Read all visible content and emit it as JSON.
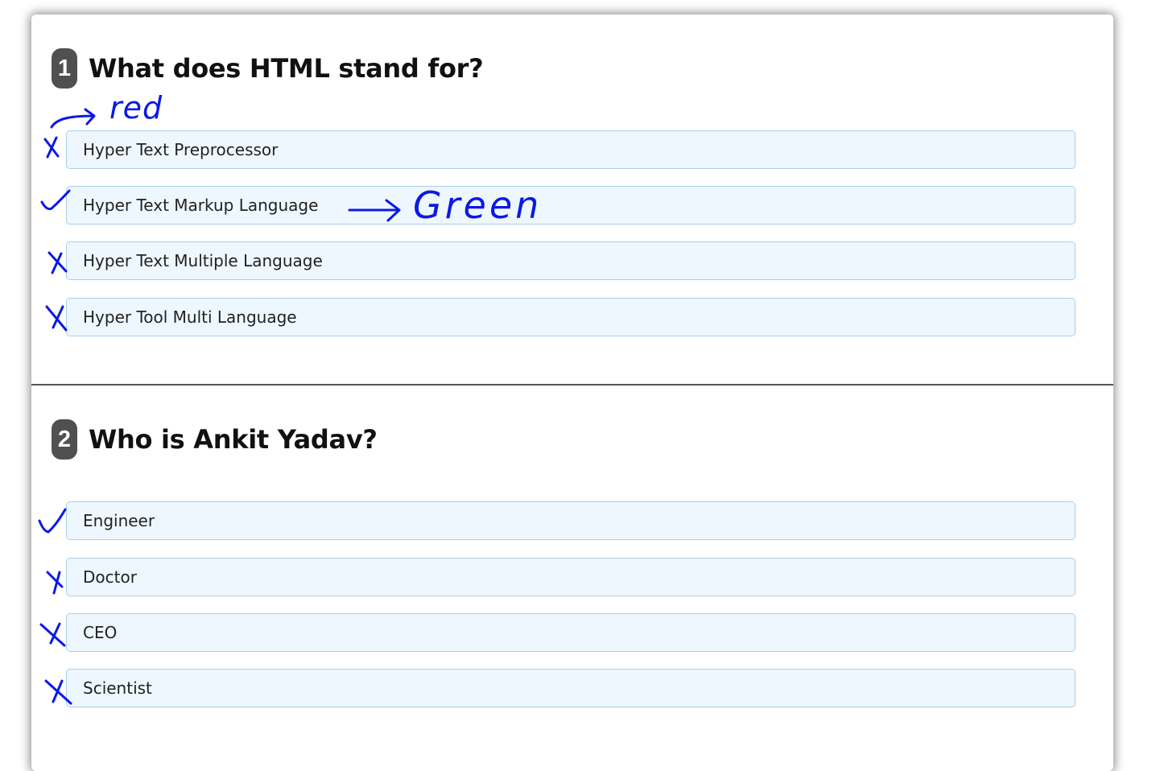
{
  "questions": [
    {
      "number": "1",
      "text": "What does HTML stand for?",
      "options": [
        {
          "label": "Hyper Text Preprocessor",
          "mark": "cross"
        },
        {
          "label": "Hyper Text Markup Language",
          "mark": "check"
        },
        {
          "label": "Hyper Text Multiple Language",
          "mark": "cross"
        },
        {
          "label": "Hyper Tool Multi Language",
          "mark": "cross"
        }
      ]
    },
    {
      "number": "2",
      "text": "Who is Ankit Yadav?",
      "options": [
        {
          "label": "Engineer",
          "mark": "check"
        },
        {
          "label": "Doctor",
          "mark": "cross"
        },
        {
          "label": "CEO",
          "mark": "cross"
        },
        {
          "label": "Scientist",
          "mark": "cross"
        }
      ]
    }
  ],
  "annotations": {
    "wrong_note": "red",
    "right_note": "Green",
    "ink_color": "#0b19e6"
  },
  "colors": {
    "option_bg": "#eef7fe",
    "option_border": "#a9cfe8",
    "badge_bg": "#505050"
  }
}
